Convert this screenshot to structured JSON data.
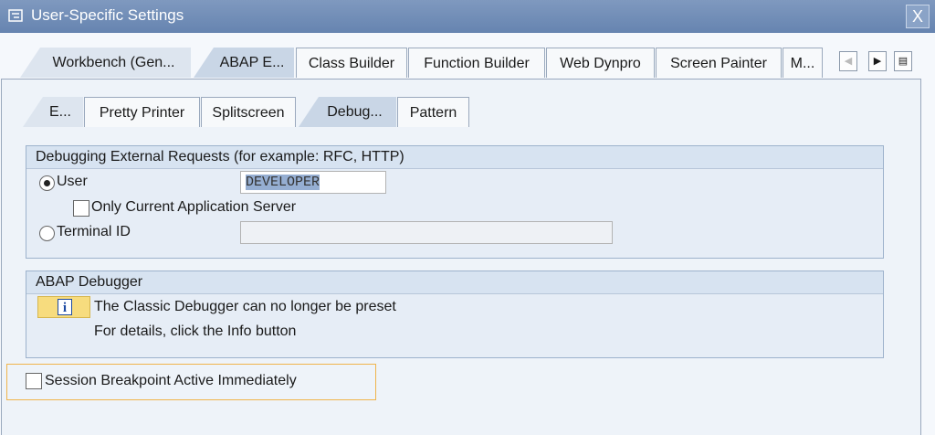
{
  "window": {
    "title": "User-Specific Settings",
    "close_label": "X"
  },
  "top_tabs": [
    "Workbench (Gen...",
    "ABAP E...",
    "Class Builder",
    "Function Builder",
    "Web Dynpro",
    "Screen Painter",
    "M..."
  ],
  "top_tabs_active": "ABAP E...",
  "sub_tabs": [
    "E...",
    "Pretty Printer",
    "Splitscreen",
    "Debug...",
    "Pattern"
  ],
  "sub_tabs_active": "Debug...",
  "external_requests": {
    "header": "Debugging External Requests (for example: RFC, HTTP)",
    "user_label": "User",
    "user_selected": true,
    "user_value": "DEVELOPER",
    "only_current_server_label": "Only Current Application Server",
    "only_current_server_checked": false,
    "terminal_label": "Terminal ID",
    "terminal_value": ""
  },
  "abap_debugger": {
    "header": "ABAP Debugger",
    "info_line1": "The Classic Debugger can no longer be preset",
    "info_line2": "For details, click the Info button"
  },
  "session_breakpoint": {
    "label": "Session Breakpoint Active Immediately",
    "checked": false
  },
  "icons": {
    "window": "settings-window-icon",
    "info": "info-icon",
    "prev": "scroll-left-icon",
    "next": "scroll-right-icon",
    "list": "tab-list-icon"
  }
}
